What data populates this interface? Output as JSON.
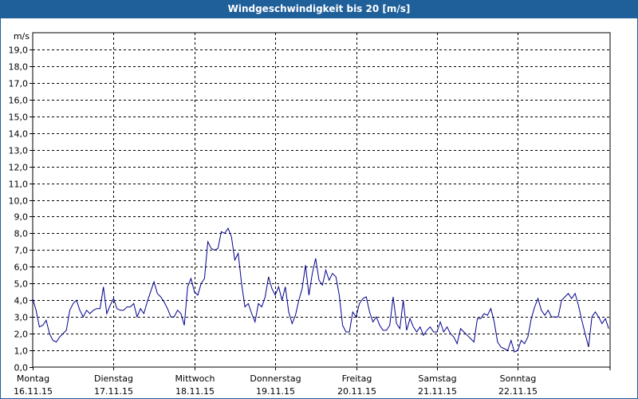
{
  "window": {
    "title": "Windgeschwindigkeit bis 20 [m/s]"
  },
  "colors": {
    "titlebar": "#1f5f9a",
    "line": "#00008b",
    "grid": "#000000"
  },
  "chart_data": {
    "type": "line",
    "title": "Windgeschwindigkeit bis 20 [m/s]",
    "ylabel": "m/s",
    "ylim": [
      0,
      20
    ],
    "grid": true,
    "legend": "none",
    "y_tick_labels": [
      "0,0",
      "1,0",
      "2,0",
      "3,0",
      "4,0",
      "5,0",
      "6,0",
      "7,0",
      "8,0",
      "9,0",
      "10,0",
      "11,0",
      "12,0",
      "13,0",
      "14,0",
      "15,0",
      "16,0",
      "17,0",
      "18,0",
      "19,0"
    ],
    "x_ticks": [
      {
        "day": "Montag",
        "date": "16.11.15"
      },
      {
        "day": "Dienstag",
        "date": "17.11.15"
      },
      {
        "day": "Mittwoch",
        "date": "18.11.15"
      },
      {
        "day": "Donnerstag",
        "date": "19.11.15"
      },
      {
        "day": "Freitag",
        "date": "20.11.15"
      },
      {
        "day": "Samstag",
        "date": "21.11.15"
      },
      {
        "day": "Sonntag",
        "date": "22.11.15"
      }
    ],
    "x_unit": "hours since 16.11.15 00:00",
    "x_range": [
      0,
      168
    ],
    "series": [
      {
        "values": [
          [
            0.0,
            4.1
          ],
          [
            1.0,
            3.4
          ],
          [
            2.0,
            2.4
          ],
          [
            3.0,
            2.5
          ],
          [
            4.0,
            2.8
          ],
          [
            5.0,
            2.0
          ],
          [
            6.0,
            1.6
          ],
          [
            7.0,
            1.5
          ],
          [
            8.0,
            1.8
          ],
          [
            9.0,
            2.0
          ],
          [
            10.0,
            2.2
          ],
          [
            11.0,
            3.4
          ],
          [
            12.0,
            3.8
          ],
          [
            13.0,
            4.0
          ],
          [
            14.0,
            3.4
          ],
          [
            15.0,
            3.0
          ],
          [
            16.0,
            3.4
          ],
          [
            17.0,
            3.2
          ],
          [
            18.0,
            3.4
          ],
          [
            19.0,
            3.5
          ],
          [
            20.0,
            3.5
          ],
          [
            21.0,
            4.8
          ],
          [
            22.0,
            3.2
          ],
          [
            23.0,
            3.7
          ],
          [
            24.0,
            4.1
          ],
          [
            25.0,
            3.5
          ],
          [
            26.0,
            3.4
          ],
          [
            27.0,
            3.4
          ],
          [
            28.0,
            3.6
          ],
          [
            29.0,
            3.6
          ],
          [
            30.0,
            3.8
          ],
          [
            31.0,
            3.0
          ],
          [
            32.0,
            3.5
          ],
          [
            33.0,
            3.2
          ],
          [
            34.0,
            3.9
          ],
          [
            35.0,
            4.5
          ],
          [
            36.0,
            5.1
          ],
          [
            37.0,
            4.4
          ],
          [
            38.0,
            4.2
          ],
          [
            39.0,
            3.9
          ],
          [
            40.0,
            3.5
          ],
          [
            41.0,
            3.0
          ],
          [
            42.0,
            3.0
          ],
          [
            43.0,
            3.4
          ],
          [
            44.0,
            3.2
          ],
          [
            45.0,
            2.5
          ],
          [
            46.0,
            4.8
          ],
          [
            47.0,
            5.3
          ],
          [
            48.0,
            4.5
          ],
          [
            49.0,
            4.3
          ],
          [
            50.0,
            5.0
          ],
          [
            51.0,
            5.3
          ],
          [
            52.0,
            7.5
          ],
          [
            53.0,
            7.1
          ],
          [
            54.0,
            7.0
          ],
          [
            55.0,
            7.1
          ],
          [
            56.0,
            8.1
          ],
          [
            57.0,
            8.0
          ],
          [
            58.0,
            8.3
          ],
          [
            59.0,
            7.8
          ],
          [
            60.0,
            6.4
          ],
          [
            61.0,
            6.8
          ],
          [
            62.0,
            5.0
          ],
          [
            63.0,
            3.6
          ],
          [
            64.0,
            3.8
          ],
          [
            65.0,
            3.2
          ],
          [
            66.0,
            2.7
          ],
          [
            67.0,
            3.8
          ],
          [
            68.0,
            3.6
          ],
          [
            69.0,
            4.2
          ],
          [
            70.0,
            5.4
          ],
          [
            71.0,
            4.7
          ],
          [
            72.0,
            4.3
          ],
          [
            73.0,
            4.8
          ],
          [
            74.0,
            4.0
          ],
          [
            75.0,
            4.8
          ],
          [
            76.0,
            3.3
          ],
          [
            77.0,
            2.6
          ],
          [
            78.0,
            3.1
          ],
          [
            79.0,
            4.0
          ],
          [
            80.0,
            4.7
          ],
          [
            81.0,
            6.1
          ],
          [
            82.0,
            4.3
          ],
          [
            83.0,
            5.6
          ],
          [
            84.0,
            6.5
          ],
          [
            85.0,
            5.2
          ],
          [
            86.0,
            4.9
          ],
          [
            87.0,
            5.8
          ],
          [
            88.0,
            5.2
          ],
          [
            89.0,
            5.6
          ],
          [
            90.0,
            5.4
          ],
          [
            91.0,
            4.3
          ],
          [
            92.0,
            2.5
          ],
          [
            93.0,
            2.1
          ],
          [
            94.0,
            2.1
          ],
          [
            95.0,
            3.3
          ],
          [
            96.0,
            3.0
          ],
          [
            97.0,
            3.8
          ],
          [
            98.0,
            4.1
          ],
          [
            99.0,
            4.2
          ],
          [
            100.0,
            3.3
          ],
          [
            101.0,
            2.7
          ],
          [
            102.0,
            3.0
          ],
          [
            103.0,
            2.5
          ],
          [
            104.0,
            2.2
          ],
          [
            105.0,
            2.2
          ],
          [
            106.0,
            2.5
          ],
          [
            107.0,
            4.2
          ],
          [
            108.0,
            2.6
          ],
          [
            109.0,
            2.3
          ],
          [
            110.0,
            4.0
          ],
          [
            111.0,
            2.2
          ],
          [
            112.0,
            2.9
          ],
          [
            113.0,
            2.4
          ],
          [
            114.0,
            2.1
          ],
          [
            115.0,
            2.4
          ],
          [
            116.0,
            1.9
          ],
          [
            117.0,
            2.2
          ],
          [
            118.0,
            2.4
          ],
          [
            119.0,
            2.1
          ],
          [
            120.0,
            2.1
          ],
          [
            121.0,
            2.7
          ],
          [
            122.0,
            2.1
          ],
          [
            123.0,
            2.4
          ],
          [
            124.0,
            2.0
          ],
          [
            125.0,
            1.8
          ],
          [
            126.0,
            1.4
          ],
          [
            127.0,
            2.3
          ],
          [
            128.0,
            2.1
          ],
          [
            129.0,
            1.9
          ],
          [
            130.0,
            1.7
          ],
          [
            131.0,
            1.5
          ],
          [
            132.0,
            2.9
          ],
          [
            133.0,
            2.9
          ],
          [
            134.0,
            3.2
          ],
          [
            135.0,
            3.1
          ],
          [
            136.0,
            3.5
          ],
          [
            137.0,
            2.7
          ],
          [
            138.0,
            1.5
          ],
          [
            139.0,
            1.2
          ],
          [
            140.0,
            1.1
          ],
          [
            141.0,
            1.0
          ],
          [
            142.0,
            1.6
          ],
          [
            143.0,
            0.9
          ],
          [
            144.0,
            1.0
          ],
          [
            145.0,
            1.6
          ],
          [
            146.0,
            1.4
          ],
          [
            147.0,
            1.8
          ],
          [
            148.0,
            2.9
          ],
          [
            149.0,
            3.6
          ],
          [
            150.0,
            4.1
          ],
          [
            151.0,
            3.4
          ],
          [
            152.0,
            3.1
          ],
          [
            153.0,
            3.4
          ],
          [
            154.0,
            3.0
          ],
          [
            155.0,
            3.0
          ],
          [
            156.0,
            3.0
          ],
          [
            157.0,
            4.0
          ],
          [
            158.0,
            4.2
          ],
          [
            159.0,
            4.4
          ],
          [
            160.0,
            4.1
          ],
          [
            161.0,
            4.4
          ],
          [
            162.0,
            3.7
          ],
          [
            163.0,
            2.8
          ],
          [
            164.0,
            2.0
          ],
          [
            165.0,
            1.2
          ],
          [
            166.0,
            3.0
          ],
          [
            167.0,
            3.3
          ],
          [
            168.0,
            3.0
          ],
          [
            169.0,
            2.6
          ],
          [
            170.0,
            2.9
          ],
          [
            171.0,
            2.3
          ]
        ]
      }
    ]
  }
}
